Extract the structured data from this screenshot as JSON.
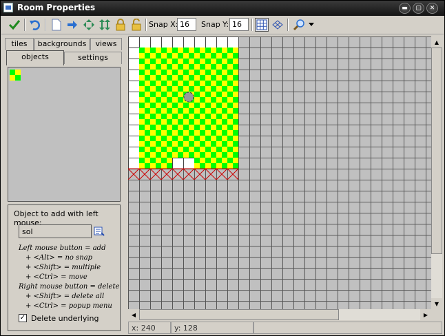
{
  "window": {
    "title": "Room Properties"
  },
  "titlebar_buttons": [
    {
      "name": "minimize",
      "glyph": "▬"
    },
    {
      "name": "maximize",
      "glyph": "▢"
    },
    {
      "name": "close",
      "glyph": "✕"
    }
  ],
  "toolbar": {
    "snap_x_label": "Snap X:",
    "snap_x_value": "16",
    "snap_y_label": "Snap Y:",
    "snap_y_value": "16",
    "icons": [
      "ok-icon",
      "undo-icon",
      "clear-icon",
      "shift-icon",
      "spread-horizontal-icon",
      "spread-vertical-icon",
      "lock-icon",
      "unlock-icon",
      "grid-icon",
      "isometric-grid-icon",
      "zoom-icon"
    ]
  },
  "tabs": {
    "row1": [
      "tiles",
      "backgrounds",
      "views"
    ],
    "row2": [
      "objects",
      "settings"
    ],
    "active": "objects"
  },
  "objects_panel": {
    "add_label": "Object to add with left mouse:",
    "selected_object": "sol",
    "help_lines": [
      "Left mouse button = add",
      "+ <Alt> = no snap",
      "+ <Shift> = multiple",
      "+ <Ctrl> = move",
      "Right mouse button = delete",
      "+ <Shift> = delete all",
      "+ <Ctrl> = popup menu"
    ],
    "delete_underlying_label": "Delete underlying",
    "delete_underlying_checked": true
  },
  "colors": {
    "tile_green": "#00ff00",
    "tile_yellow": "#ffff00",
    "outside_room_marker": "#cc0000"
  },
  "status": {
    "x": "x: 240",
    "y": "y: 128"
  }
}
